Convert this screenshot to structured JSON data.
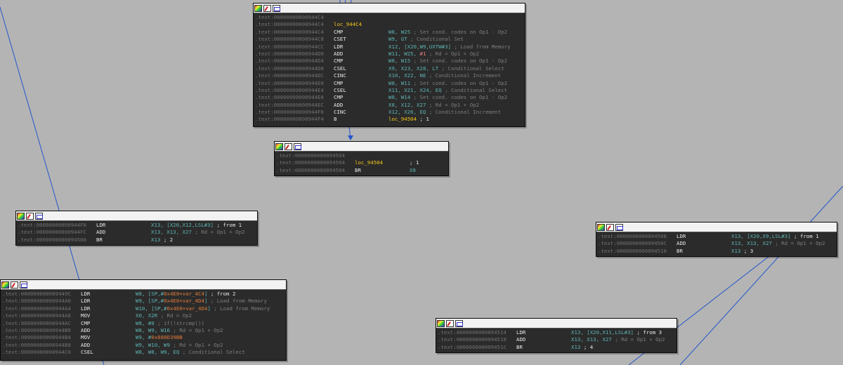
{
  "nodes": {
    "top": {
      "rows": [
        {
          "addr": ".text:00000000000944C4",
          "mn": "",
          "ops": "",
          "cm": ""
        },
        {
          "addr": ".text:00000000000944C4",
          "mn": "loc_944C4",
          "ops": "",
          "cm": ""
        },
        {
          "addr": ".text:00000000000944C4",
          "mn": "CMP",
          "ops": "W8, W25",
          "cm": "; Set cond. codes on Op1 - Op2"
        },
        {
          "addr": ".text:00000000000944C8",
          "mn": "CSET",
          "ops": "W9, GT",
          "cm": "; Conditional Set"
        },
        {
          "addr": ".text:00000000000944CC",
          "mn": "LDR",
          "ops": "X12, [X20,W9,UXTW#3]",
          "cm": "; Load from Memory"
        },
        {
          "addr": ".text:00000000000944D0",
          "mn": "ADD",
          "ops": "W11, W25, ",
          "imm": "#1",
          "cm": "; Rd = Op1 + Op2"
        },
        {
          "addr": ".text:00000000000944D4",
          "mn": "CMP",
          "ops": "W8, W15",
          "cm": "; Set cond. codes on Op1 - Op2"
        },
        {
          "addr": ".text:00000000000944D8",
          "mn": "CSEL",
          "ops": "X9, X23, X28, LT",
          "cm": "; Conditional Select"
        },
        {
          "addr": ".text:00000000000944DC",
          "mn": "CINC",
          "ops": "X10, X22, NE",
          "cm": "; Conditional Increment"
        },
        {
          "addr": ".text:00000000000944E0",
          "mn": "CMP",
          "ops": "W8, W11",
          "cm": "; Set cond. codes on Op1 - Op2"
        },
        {
          "addr": ".text:00000000000944E4",
          "mn": "CSEL",
          "ops": "X11, X21, X24, EQ",
          "cm": "; Conditional Select"
        },
        {
          "addr": ".text:00000000000944E8",
          "mn": "CMP",
          "ops": "W8, W14",
          "cm": "; Set cond. codes on Op1 - Op2"
        },
        {
          "addr": ".text:00000000000944EC",
          "mn": "ADD",
          "ops": "X8, X12, X27",
          "cm": "; Rd = Op1 + Op2"
        },
        {
          "addr": ".text:00000000000944F0",
          "mn": "CINC",
          "ops": "X12, X26, EQ",
          "cm": "; Conditional Increment"
        },
        {
          "addr": ".text:00000000000944F4",
          "mn": "B",
          "ops": "",
          "label_op": "loc_94504",
          "cm": "; 1"
        }
      ]
    },
    "mid": {
      "rows": [
        {
          "addr": ".text:0000000000094504",
          "mn": "",
          "ops": "",
          "cm": ""
        },
        {
          "addr": ".text:0000000000094504",
          "mn": "loc_94504",
          "ops": "",
          "cm": "; 1"
        },
        {
          "addr": ".text:0000000000094504",
          "mn": "BR",
          "ops": "X8",
          "cm": ""
        }
      ]
    },
    "left1": {
      "rows": [
        {
          "addr": ".text:00000000000944F8",
          "mn": "LDR",
          "ops": "X13, [X20,X12,LSL#3]",
          "cm": "; from 1"
        },
        {
          "addr": ".text:00000000000944FC",
          "mn": "ADD",
          "ops": "X13, X13, X27",
          "cm": "; Rd = Op1 + Op2"
        },
        {
          "addr": ".text:0000000000094500",
          "mn": "BR",
          "ops": "X13",
          "cm": "; 2"
        }
      ]
    },
    "right1": {
      "rows": [
        {
          "addr": ".text:0000000000094508",
          "mn": "LDR",
          "ops": "X13, [X20,X9,LSL#3]",
          "cm": "; from 1"
        },
        {
          "addr": ".text:000000000009450C",
          "mn": "ADD",
          "ops": "X13, X13, X27",
          "cm": "; Rd = Op1 + Op2"
        },
        {
          "addr": ".text:0000000000094510",
          "mn": "BR",
          "ops": "X13",
          "cm": "; 3"
        }
      ]
    },
    "left2": {
      "rows": [
        {
          "addr": ".text:000000000009449C",
          "mn": "LDR",
          "ops_pre": "W8, [SP,#",
          "hl": "0x4E0+var_4C4",
          "ops_post": "]",
          "cm": "; from 2"
        },
        {
          "addr": ".text:00000000000944A0",
          "mn": "LDR",
          "ops_pre": "W9, [SP,#",
          "hl": "0x4E0+var_4D4",
          "ops_post": "]",
          "cm": "; Load from Memory"
        },
        {
          "addr": ".text:00000000000944A4",
          "mn": "LDR",
          "ops_pre": "W10, [SP,#",
          "hl": "0x4E0+var_4D4",
          "ops_post": "]",
          "cm": "; Load from Memory"
        },
        {
          "addr": ".text:00000000000944A8",
          "mn": "MOV",
          "ops": "X0, X2R",
          "cm": "; Rd = Op2"
        },
        {
          "addr": ".text:00000000000944AC",
          "mn": "CMP",
          "ops": "W8, #0",
          "cm": "; if(!strcmp())"
        },
        {
          "addr": ".text:00000000000944B0",
          "mn": "ADD",
          "ops": "W8, W9, W16",
          "cm": "; Rd = Op1 + Op2"
        },
        {
          "addr": ".text:00000000000944B4",
          "mn": "MOV",
          "ops_pre": "W9, #",
          "hl": "0x888D39BB",
          "ops_post": "",
          "cm": ""
        },
        {
          "addr": ".text:00000000000944B8",
          "mn": "ADD",
          "ops": "W9, W10, W9",
          "cm": "; Rd = Op1 + Op2"
        },
        {
          "addr": ".text:00000000000944C0",
          "mn": "CSEL",
          "ops": "W8, W8, W9, EQ",
          "cm": "; Conditional Select"
        }
      ]
    },
    "bottom": {
      "rows": [
        {
          "addr": ".text:0000000000094514",
          "mn": "LDR",
          "ops": "X13, [X20,X11,LSL#3]",
          "cm": "; from 3"
        },
        {
          "addr": ".text:0000000000094518",
          "mn": "ADD",
          "ops": "X13, X13, X27",
          "cm": "; Rd = Op1 + Op2"
        },
        {
          "addr": ".text:000000000009451C",
          "mn": "BR",
          "ops": "X13",
          "cm": "; 4"
        }
      ]
    }
  },
  "colors": {
    "canvas": "#b4b4b4",
    "node_bg": "#2b2b2b",
    "edge": "#2255cc",
    "address": "#727272",
    "label": "#f5c518",
    "operand": "#5fb3b3",
    "comment": "#7d7d7d"
  },
  "icons": [
    "color-palette-icon",
    "edit-pen-icon",
    "graph-view-icon"
  ]
}
